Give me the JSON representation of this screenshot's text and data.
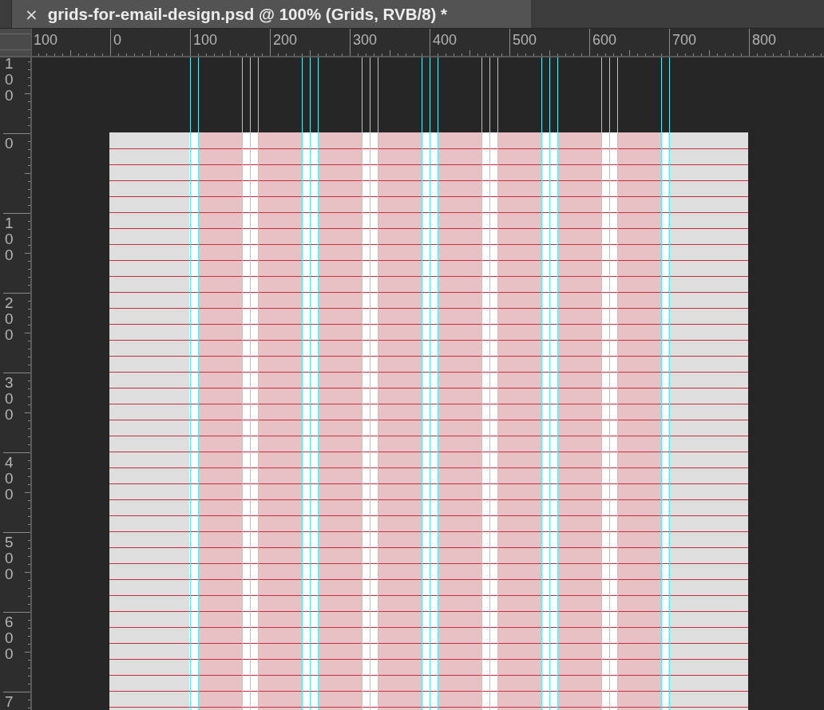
{
  "document_tab": {
    "close": "×",
    "title": "grids-for-email-design.psd @ 100% (Grids, RVB/8) *"
  },
  "top_ruler": {
    "labels": [
      "100",
      "0",
      "100",
      "200",
      "300",
      "400",
      "500",
      "600",
      "700",
      "800"
    ]
  },
  "left_ruler": {
    "labels": [
      "100",
      "0",
      "100",
      "200",
      "300",
      "400",
      "500",
      "600",
      "7"
    ]
  }
}
